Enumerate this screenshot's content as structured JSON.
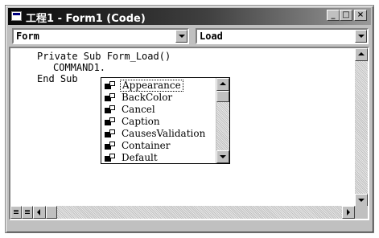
{
  "window": {
    "title": "工程1 - Form1 (Code)",
    "minimize": "_",
    "maximize": "□",
    "close": "×"
  },
  "object_combo": {
    "value": "Form"
  },
  "procedure_combo": {
    "value": "Load"
  },
  "code": {
    "lines": [
      "Private Sub Form_Load()",
      "COMMAND1.",
      "End Sub"
    ]
  },
  "autocomplete": {
    "items": [
      "Appearance",
      "BackColor",
      "Cancel",
      "Caption",
      "CausesValidation",
      "Container",
      "Default"
    ],
    "selected": "Appearance",
    "icon": "property-icon"
  },
  "icons": {
    "window": "code-window-icon",
    "procedure_view": "procedure-view-icon",
    "full_module_view": "full-module-view-icon"
  }
}
